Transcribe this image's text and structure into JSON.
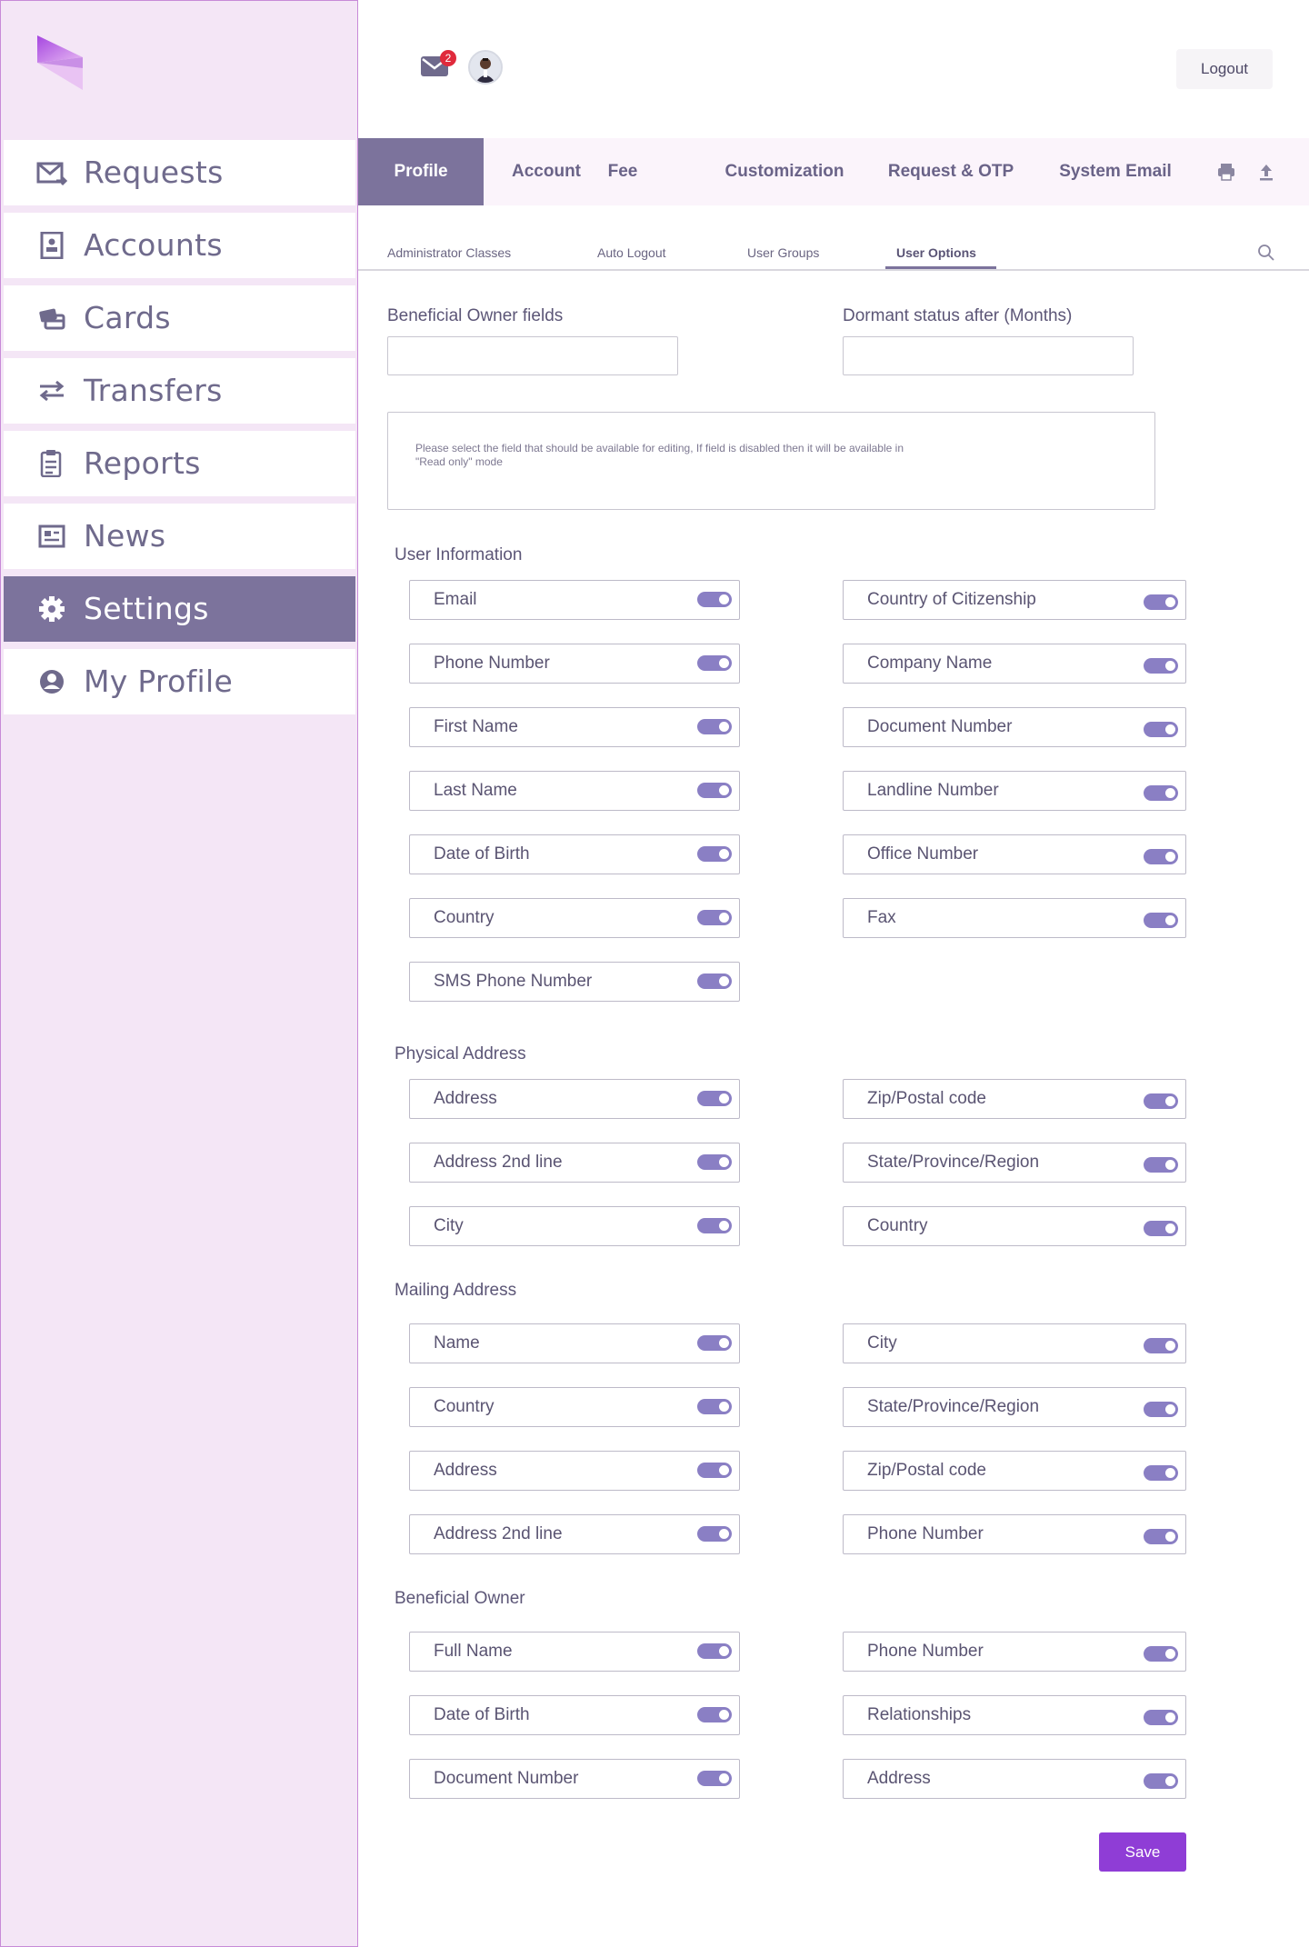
{
  "sidebar": {
    "items": [
      {
        "label": "Requests",
        "icon": "mail-arrow-icon",
        "active": false
      },
      {
        "label": "Accounts",
        "icon": "account-book-icon",
        "active": false
      },
      {
        "label": "Cards",
        "icon": "cards-icon",
        "active": false
      },
      {
        "label": "Transfers",
        "icon": "transfer-arrows-icon",
        "active": false
      },
      {
        "label": "Reports",
        "icon": "clipboard-icon",
        "active": false
      },
      {
        "label": "News",
        "icon": "newspaper-icon",
        "active": false
      },
      {
        "label": "Settings",
        "icon": "gear-icon",
        "active": true
      },
      {
        "label": "My Profile",
        "icon": "user-circle-icon",
        "active": false
      }
    ]
  },
  "header": {
    "mail_count": "2",
    "logout_label": "Logout"
  },
  "tabs": [
    {
      "label": "Profile",
      "active": true
    },
    {
      "label": "Account",
      "active": false
    },
    {
      "label": "Fee",
      "active": false
    },
    {
      "label": "Customization",
      "active": false
    },
    {
      "label": "Request & OTP",
      "active": false
    },
    {
      "label": "System Email",
      "active": false
    }
  ],
  "subtabs": [
    {
      "label": "Administrator Classes",
      "active": false
    },
    {
      "label": "Auto Logout",
      "active": false
    },
    {
      "label": "User Groups",
      "active": false
    },
    {
      "label": "User Options",
      "active": true
    }
  ],
  "form": {
    "beneficial_owner_label": "Beneficial Owner fields",
    "beneficial_owner_value": "",
    "dormant_label": "Dormant status after (Months)",
    "dormant_value": "",
    "notice": "Please select the field that should be available for editing, If field is disabled then it will be available in \"Read only\" mode"
  },
  "sections": {
    "user_information": {
      "title": "User Information",
      "left": [
        "Email",
        "Phone Number",
        "First Name",
        "Last Name",
        "Date of Birth",
        "Country",
        "SMS Phone Number"
      ],
      "right": [
        "Country of Citizenship",
        "Company Name",
        "Document Number",
        "Landline Number",
        "Office Number",
        "Fax"
      ]
    },
    "physical_address": {
      "title": "Physical Address",
      "left": [
        "Address",
        "Address 2nd line",
        "City"
      ],
      "right": [
        "Zip/Postal code",
        "State/Province/Region",
        "Country"
      ]
    },
    "mailing_address": {
      "title": "Mailing Address",
      "left": [
        "Name",
        "Country",
        "Address",
        "Address 2nd line"
      ],
      "right": [
        "City",
        "State/Province/Region",
        "Zip/Postal code",
        "Phone Number"
      ]
    },
    "beneficial_owner": {
      "title": "Beneficial Owner",
      "left": [
        "Full Name",
        "Date of Birth",
        "Document Number"
      ],
      "right": [
        "Phone Number",
        "Relationships",
        "Address"
      ]
    }
  },
  "save_label": "Save",
  "colors": {
    "accent": "#7c739c",
    "toggle_on": "#8a7fc4",
    "save": "#8f3dd6",
    "sidebar_bg": "#f4e6f6"
  }
}
